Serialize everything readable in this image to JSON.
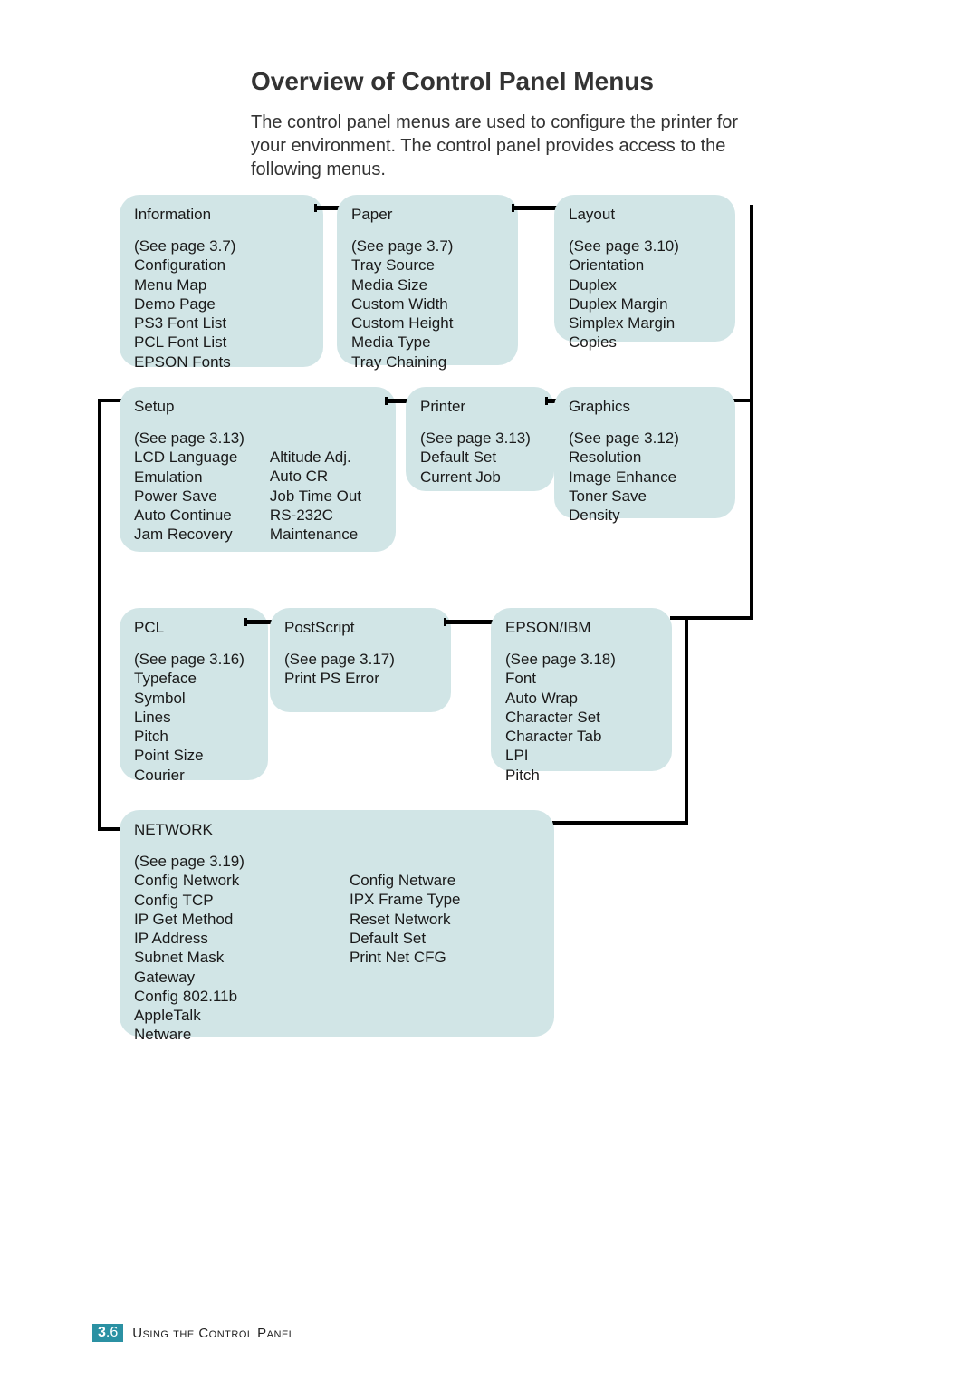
{
  "heading": "Overview of Control Panel Menus",
  "intro": "The control panel menus are used to configure the printer for your environment. The control panel provides access to the following menus.",
  "menus": {
    "information": {
      "title": "Information",
      "page_ref": "(See page 3.7)",
      "items": [
        "Configuration",
        "Menu Map",
        "Demo Page",
        "PS3 Font List",
        "PCL Font List",
        "EPSON Fonts"
      ]
    },
    "paper": {
      "title": "Paper",
      "page_ref": "(See page 3.7)",
      "items": [
        "Tray Source",
        "Media Size",
        "Custom Width",
        "Custom Height",
        "Media Type",
        "Tray Chaining"
      ]
    },
    "layout": {
      "title": "Layout",
      "page_ref": "(See page 3.10)",
      "items": [
        "Orientation",
        "Duplex",
        "Duplex Margin",
        "Simplex Margin",
        "Copies"
      ]
    },
    "setup": {
      "title": "Setup",
      "page_ref": "(See page 3.13)",
      "col1": [
        "LCD Language",
        "Emulation",
        "Power Save",
        "Auto Continue",
        "Jam Recovery"
      ],
      "col2": [
        "Altitude Adj.",
        "Auto CR",
        "Job Time Out",
        "RS-232C",
        "Maintenance"
      ]
    },
    "printer": {
      "title": "Printer",
      "page_ref": "(See page 3.13)",
      "items": [
        "Default Set",
        "Current Job"
      ]
    },
    "graphics": {
      "title": "Graphics",
      "page_ref": "(See page 3.12)",
      "items": [
        "Resolution",
        "Image Enhance",
        "Toner Save",
        "Density"
      ]
    },
    "pcl": {
      "title": "PCL",
      "page_ref": "(See page 3.16)",
      "items": [
        "Typeface",
        "Symbol",
        "Lines",
        "Pitch",
        "Point Size",
        "Courier"
      ]
    },
    "postscript": {
      "title": "PostScript",
      "page_ref": "(See page 3.17)",
      "items": [
        "Print PS Error"
      ]
    },
    "epson": {
      "title": "EPSON/IBM",
      "page_ref": "(See page 3.18)",
      "items": [
        "Font",
        "Auto Wrap",
        "Character Set",
        "Character Tab",
        "LPI",
        "Pitch"
      ]
    },
    "network": {
      "title": "NETWORK",
      "page_ref": "(See page 3.19)",
      "col1": [
        "Config Network",
        "Config TCP",
        "IP Get Method",
        "IP Address",
        "Subnet Mask",
        "Gateway",
        "Config 802.11b",
        "AppleTalk",
        "Netware"
      ],
      "col2": [
        "Config Netware",
        "IPX Frame Type",
        "Reset Network",
        "Default Set",
        "Print Net CFG"
      ]
    }
  },
  "footer": {
    "chapter": "3",
    "page": "6",
    "title": "Using the Control Panel"
  }
}
